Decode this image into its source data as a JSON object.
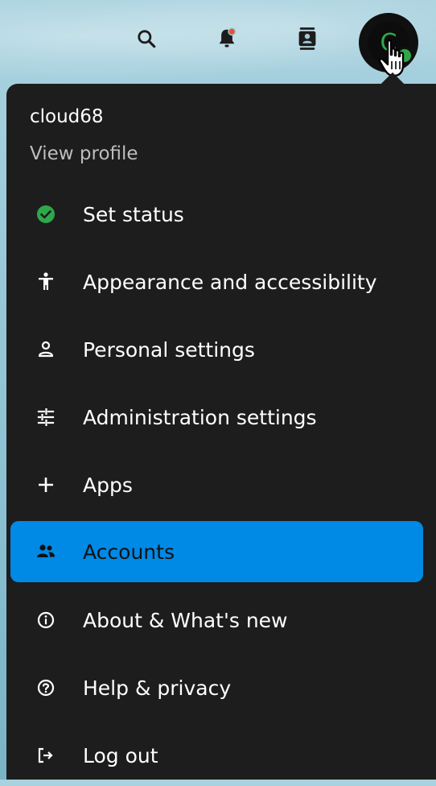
{
  "header": {
    "icons": [
      "search-icon",
      "notifications-icon",
      "contacts-icon"
    ],
    "avatar_letter": "C",
    "status_color": "#2ea84a"
  },
  "menu": {
    "username": "cloud68",
    "view_profile": "View profile",
    "items": [
      {
        "label": "Set status",
        "icon": "status-online-icon"
      },
      {
        "label": "Appearance and accessibility",
        "icon": "accessibility-icon"
      },
      {
        "label": "Personal settings",
        "icon": "person-icon"
      },
      {
        "label": "Administration settings",
        "icon": "sliders-icon"
      },
      {
        "label": "Apps",
        "icon": "plus-icon"
      },
      {
        "label": "Accounts",
        "icon": "accounts-icon",
        "active": true
      },
      {
        "label": "About & What's new",
        "icon": "info-icon"
      },
      {
        "label": "Help & privacy",
        "icon": "help-icon"
      },
      {
        "label": "Log out",
        "icon": "logout-icon"
      }
    ],
    "active_color": "#0089e5"
  }
}
